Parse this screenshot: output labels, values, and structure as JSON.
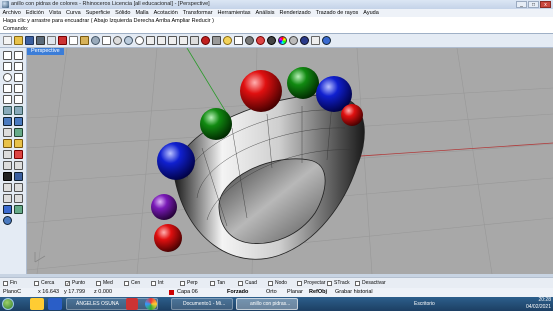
{
  "window": {
    "title": "anillo con pidras de colores - Rhinoceros Licencia [all educacional] - [Perspective]",
    "buttons": [
      "_",
      "□",
      "x"
    ]
  },
  "menu": [
    "Archivo",
    "Edición",
    "Vista",
    "Curva",
    "Superficie",
    "Sólido",
    "Malla",
    "Acotación",
    "Transformar",
    "Herramientas",
    "Análisis",
    "Renderizado",
    "Trazado de rayos",
    "Ayuda"
  ],
  "command": {
    "history": "Haga clic y arrastre para encuadrar ( Abajo  Izquierda  Derecha  Arriba  Ampliar  Reducir )",
    "prompt": "Comando:"
  },
  "viewport": {
    "label": "Perspective"
  },
  "osnap": [
    {
      "label": "Fin",
      "checked": false
    },
    {
      "label": "Cerca",
      "checked": false
    },
    {
      "label": "Punto",
      "checked": true
    },
    {
      "label": "Med",
      "checked": false
    },
    {
      "label": "Cen",
      "checked": false
    },
    {
      "label": "Int",
      "checked": false
    },
    {
      "label": "Perp",
      "checked": false
    },
    {
      "label": "Tan",
      "checked": false
    },
    {
      "label": "Cuad",
      "checked": false
    },
    {
      "label": "Nodo",
      "checked": false
    },
    {
      "label": "Proyectar",
      "checked": false
    },
    {
      "label": "STrack",
      "checked": false
    },
    {
      "label": "Desactivar",
      "checked": false
    }
  ],
  "status": {
    "cplane": "PlanoC",
    "x": "x 16.643",
    "y": "y 17.799",
    "z": "z 0.000",
    "layer": "Capa 06",
    "forzado": "Forzado",
    "orto": "Orto",
    "planar": "Planar",
    "refobj": "RefObj",
    "history": "Grabar historial"
  },
  "taskbar": {
    "items": [
      "ÁNGELES OSUNA",
      "Documento1 - Mi...",
      "anillo con pidras..."
    ],
    "tray_label": "Escritorio",
    "time": "20:28",
    "date": "04/02/2021"
  }
}
